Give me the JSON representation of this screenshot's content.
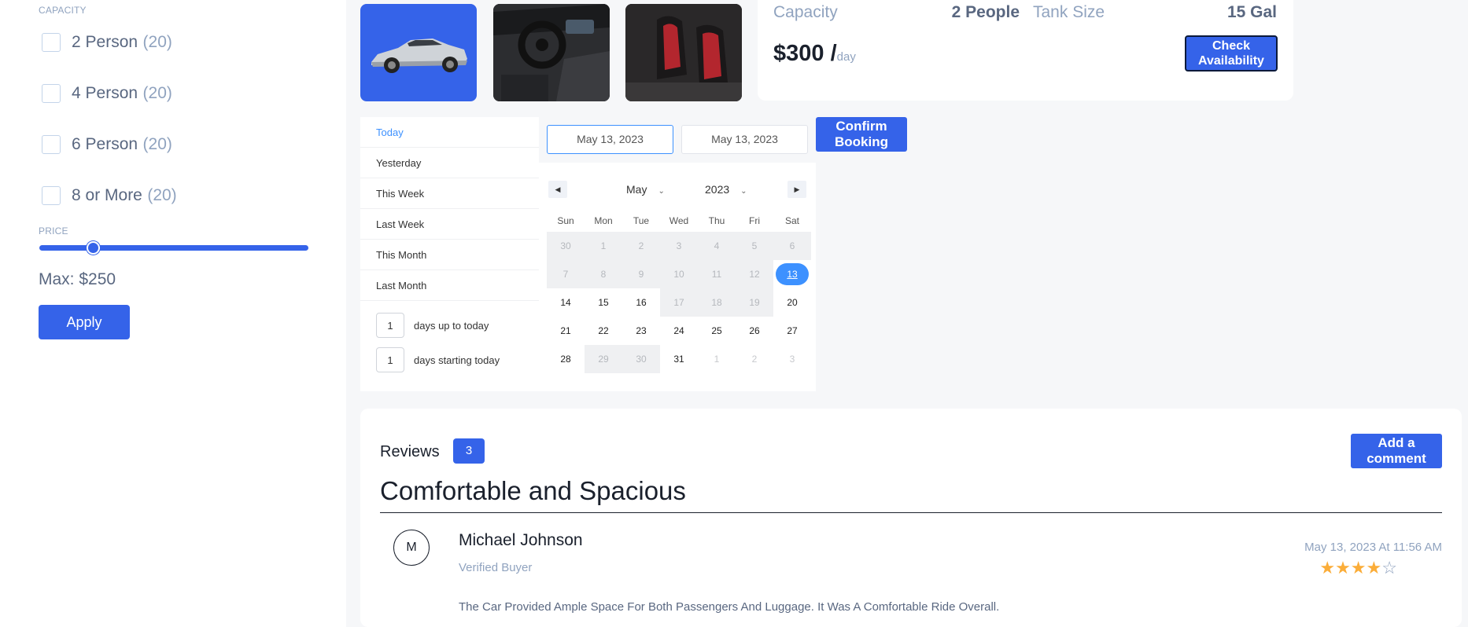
{
  "filters": {
    "capacity_title": "CAPACITY",
    "capacity_options": [
      {
        "label": "2 Person",
        "count": "(20)"
      },
      {
        "label": "4 Person",
        "count": "(20)"
      },
      {
        "label": "6 Person",
        "count": "(20)"
      },
      {
        "label": "8 or More",
        "count": "(20)"
      }
    ],
    "price_title": "PRICE",
    "price_slider_fraction": 0.2,
    "max_label": "Max: $250",
    "apply_label": "Apply"
  },
  "car": {
    "capacity_label": "Capacity",
    "capacity_value": "2 People",
    "tank_label": "Tank Size",
    "tank_value": "15 Gal",
    "price": "$300 /",
    "price_unit": "day",
    "check_label": "Check Availability"
  },
  "datepicker": {
    "ranges": [
      "Today",
      "Yesterday",
      "This Week",
      "Last Week",
      "This Month",
      "Last Month"
    ],
    "active_range": "Today",
    "days_up_value": "1",
    "days_up_label": "days up to today",
    "days_start_value": "1",
    "days_start_label": "days starting today",
    "start_date": "May 13, 2023",
    "end_date": "May 13, 2023",
    "confirm_label": "Confirm Booking",
    "month": "May",
    "year": "2023",
    "weekdays": [
      "Sun",
      "Mon",
      "Tue",
      "Wed",
      "Thu",
      "Fri",
      "Sat"
    ],
    "weeks": [
      [
        {
          "d": "30",
          "s": "disabled"
        },
        {
          "d": "1",
          "s": "disabled"
        },
        {
          "d": "2",
          "s": "disabled"
        },
        {
          "d": "3",
          "s": "disabled"
        },
        {
          "d": "4",
          "s": "disabled"
        },
        {
          "d": "5",
          "s": "disabled"
        },
        {
          "d": "6",
          "s": "disabled"
        }
      ],
      [
        {
          "d": "7",
          "s": "disabled"
        },
        {
          "d": "8",
          "s": "disabled"
        },
        {
          "d": "9",
          "s": "disabled"
        },
        {
          "d": "10",
          "s": "disabled"
        },
        {
          "d": "11",
          "s": "disabled"
        },
        {
          "d": "12",
          "s": "disabled"
        },
        {
          "d": "13",
          "s": "selected"
        }
      ],
      [
        {
          "d": "14",
          "s": ""
        },
        {
          "d": "15",
          "s": ""
        },
        {
          "d": "16",
          "s": ""
        },
        {
          "d": "17",
          "s": "disabled"
        },
        {
          "d": "18",
          "s": "disabled"
        },
        {
          "d": "19",
          "s": "disabled"
        },
        {
          "d": "20",
          "s": ""
        }
      ],
      [
        {
          "d": "21",
          "s": ""
        },
        {
          "d": "22",
          "s": ""
        },
        {
          "d": "23",
          "s": ""
        },
        {
          "d": "24",
          "s": ""
        },
        {
          "d": "25",
          "s": ""
        },
        {
          "d": "26",
          "s": ""
        },
        {
          "d": "27",
          "s": ""
        }
      ],
      [
        {
          "d": "28",
          "s": ""
        },
        {
          "d": "29",
          "s": "disabled"
        },
        {
          "d": "30",
          "s": "disabled"
        },
        {
          "d": "31",
          "s": ""
        },
        {
          "d": "1",
          "s": "passive"
        },
        {
          "d": "2",
          "s": "passive"
        },
        {
          "d": "3",
          "s": "passive"
        }
      ]
    ]
  },
  "reviews": {
    "title": "Reviews",
    "count": "3",
    "add_label": "Add a comment",
    "heading": "Comfortable and Spacious",
    "items": [
      {
        "avatar": "M",
        "name": "Michael Johnson",
        "role": "Verified Buyer",
        "date": "May 13, 2023 At 11:56 AM",
        "rating": 4,
        "text": "The Car Provided Ample Space For Both Passengers And Luggage. It Was A Comfortable Ride Overall."
      }
    ]
  },
  "colors": {
    "accent": "#3563e9",
    "muted": "#90a3bf",
    "star": "#fbad39",
    "calendar_selected": "#3d91ff"
  }
}
